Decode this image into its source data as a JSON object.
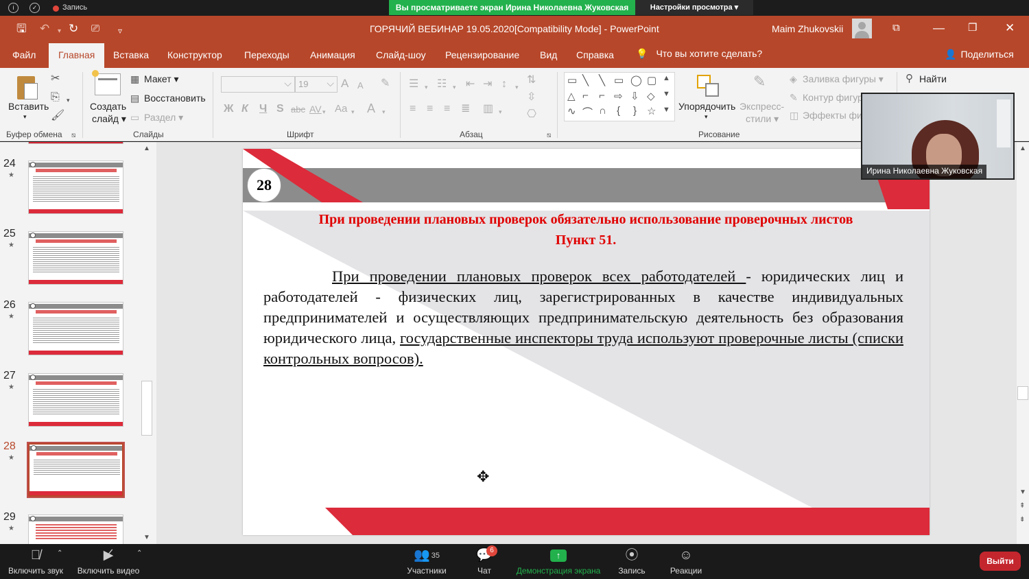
{
  "zoom_top": {
    "recording": "Запись",
    "share_banner": "Вы просматриваете экран Ирина Николаевна Жуковская",
    "view_settings": "Настройки просмотра ▾"
  },
  "titlebar": {
    "doc_title": "ГОРЯЧИЙ ВЕБИНАР 19.05.2020[Compatibility Mode]  -  PowerPoint",
    "user": "Maim Zhukovskii"
  },
  "tabs": [
    "Файл",
    "Главная",
    "Вставка",
    "Конструктор",
    "Переходы",
    "Анимация",
    "Слайд-шоу",
    "Рецензирование",
    "Вид",
    "Справка"
  ],
  "tell_me": "Что вы хотите сделать?",
  "share": "Поделиться",
  "ribbon": {
    "paste": "Вставить",
    "new_slide_1": "Создать",
    "new_slide_2": "слайд ▾",
    "layout": "Макет ▾",
    "reset": "Восстановить",
    "section": "Раздел ▾",
    "font_size": "19",
    "font_bold": "Ж",
    "font_italic": "К",
    "font_underline": "Ч",
    "font_shadow": "S",
    "font_strike": "abc",
    "font_spacing": "AV",
    "font_case": "Aa",
    "font_color": "A",
    "grow_font": "A",
    "shrink_font": "A",
    "arrange": "Упорядочить",
    "quick_styles_1": "Экспресс-",
    "quick_styles_2": "стили ▾",
    "shape_fill": "Заливка фигуры ▾",
    "shape_outline": "Контур фигур",
    "shape_effects": "Эффекты фиг",
    "find": "Найти",
    "groups": {
      "clipboard": "Буфер обмена",
      "slides": "Слайды",
      "font": "Шрифт",
      "paragraph": "Абзац",
      "drawing": "Рисование"
    }
  },
  "thumbnails": [
    {
      "num": "24",
      "star": "★"
    },
    {
      "num": "25",
      "star": "★"
    },
    {
      "num": "26",
      "star": "★"
    },
    {
      "num": "27",
      "star": "★"
    },
    {
      "num": "28",
      "star": "★"
    },
    {
      "num": "29",
      "star": "★"
    }
  ],
  "slide": {
    "number": "28",
    "title_line1": "При проведении плановых проверок обязательно использование проверочных листов",
    "title_line2": "Пункт 51.",
    "body_u1": "При проведении плановых проверок всех работодателей ",
    "body_t1": "- юридических лиц и работодателей - физических лиц, зарегистрированных в качестве индивидуальных предпринимателей и осуществляющих предпринимательскую деятельность без образования юридического лица, ",
    "body_u2": "государственные инспекторы труда используют проверочные листы (списки контрольных вопросов).",
    "colors": {
      "accent_red": "#dc2b3a",
      "gray_band": "#8c8c8c",
      "title_red": "#e00000"
    }
  },
  "webcam": {
    "name": "Ирина Николаевна Жуковская"
  },
  "zoom_bottom": {
    "mute": "Включить звук",
    "video": "Включить видео",
    "participants": "Участники",
    "participants_count": "35",
    "chat": "Чат",
    "chat_badge": "6",
    "share_screen": "Демонстрация экрана",
    "record": "Запись",
    "reactions": "Реакции",
    "leave": "Выйти"
  }
}
